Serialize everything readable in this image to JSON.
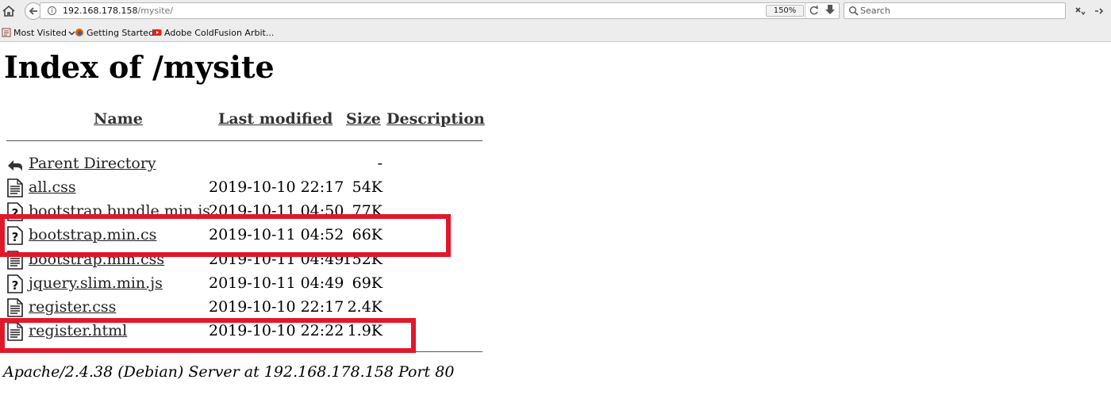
{
  "browser": {
    "url_host": "192.168.178.158",
    "url_path": "/mysite/",
    "zoom": "150%",
    "search_placeholder": "Search",
    "bookmarks": [
      {
        "label": "Most Visited",
        "icon": "most-visited-icon"
      },
      {
        "label": "Getting Started",
        "icon": "firefox-icon"
      },
      {
        "label": "Adobe ColdFusion Arbit...",
        "icon": "youtube-icon"
      }
    ]
  },
  "page": {
    "title": "Index of /mysite",
    "columns": {
      "name": "Name",
      "last_modified": "Last modified",
      "size": "Size",
      "description": "Description"
    },
    "rows": [
      {
        "name": "Parent Directory",
        "modified": "",
        "size": "-",
        "icon": "back-arrow-icon"
      },
      {
        "name": "all.css",
        "modified": "2019-10-10 22:17",
        "size": "54K",
        "icon": "text-file-icon"
      },
      {
        "name": "bootstrap.bundle.min.js",
        "modified": "2019-10-11 04:50",
        "size": "77K",
        "icon": "unknown-file-icon"
      },
      {
        "name": "bootstrap.min.cs",
        "modified": "2019-10-11 04:52",
        "size": "66K",
        "icon": "unknown-file-icon"
      },
      {
        "name": "bootstrap.min.css",
        "modified": "2019-10-11 04:49",
        "size": "152K",
        "icon": "text-file-icon"
      },
      {
        "name": "jquery.slim.min.js",
        "modified": "2019-10-11 04:49",
        "size": "69K",
        "icon": "unknown-file-icon"
      },
      {
        "name": "register.css",
        "modified": "2019-10-10 22:17",
        "size": "2.4K",
        "icon": "text-file-icon"
      },
      {
        "name": "register.html",
        "modified": "2019-10-10 22:22",
        "size": "1.9K",
        "icon": "text-file-icon"
      }
    ],
    "footer": "Apache/2.4.38 (Debian) Server at 192.168.178.158 Port 80"
  },
  "colors": {
    "highlight": "#e0182a",
    "link": "#222222",
    "chrome": "#ededed"
  }
}
